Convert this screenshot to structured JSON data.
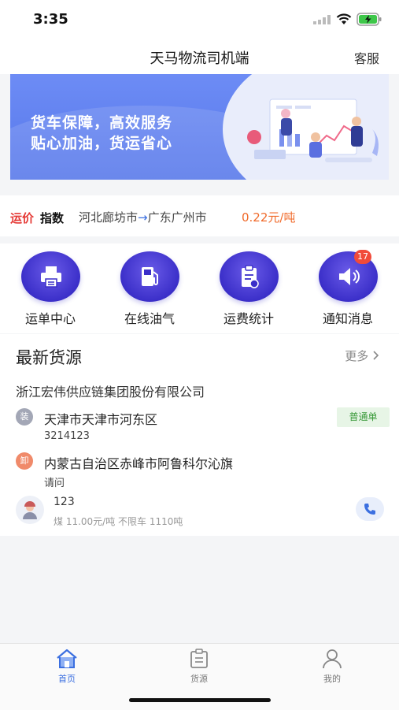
{
  "status_bar": {
    "time": "3:35"
  },
  "header": {
    "title": "天马物流司机端",
    "service_label": "客服"
  },
  "banner": {
    "line1": "货车保障，高效服务",
    "line2": "贴心加油，货运省心"
  },
  "price_index": {
    "logo_part1": "运价",
    "logo_part2": "指数",
    "from": "河北廊坊市",
    "arrow": "→",
    "to": "广东广州市",
    "price": "0.22元/吨"
  },
  "menu": [
    {
      "label": "运单中心",
      "icon": "printer-icon"
    },
    {
      "label": "在线油气",
      "icon": "fuel-pump-icon"
    },
    {
      "label": "运费统计",
      "icon": "clipboard-icon"
    },
    {
      "label": "通知消息",
      "icon": "speaker-icon",
      "badge": "17"
    }
  ],
  "cargo": {
    "title": "最新货源",
    "more_label": "更多",
    "company": "浙江宏伟供应链集团股份有限公司",
    "load_tag": "装",
    "load_address": "天津市天津市河东区",
    "load_detail": "3214123",
    "unload_tag": "卸",
    "unload_address": "内蒙古自治区赤峰市阿鲁科尔沁旗",
    "unload_detail": "请问",
    "order_type": "普通单",
    "contact_name": "123",
    "goods_info": "煤 11.00元/吨 不限车 1110吨"
  },
  "tabbar": [
    {
      "label": "首页",
      "icon": "home-icon",
      "active": true
    },
    {
      "label": "货源",
      "icon": "document-icon",
      "active": false
    },
    {
      "label": "我的",
      "icon": "user-icon",
      "active": false
    }
  ],
  "colors": {
    "accent": "#3b6fe0",
    "price": "#f06a2a",
    "menu_circle": "#3b2fc9",
    "badge": "#f14a3a"
  }
}
